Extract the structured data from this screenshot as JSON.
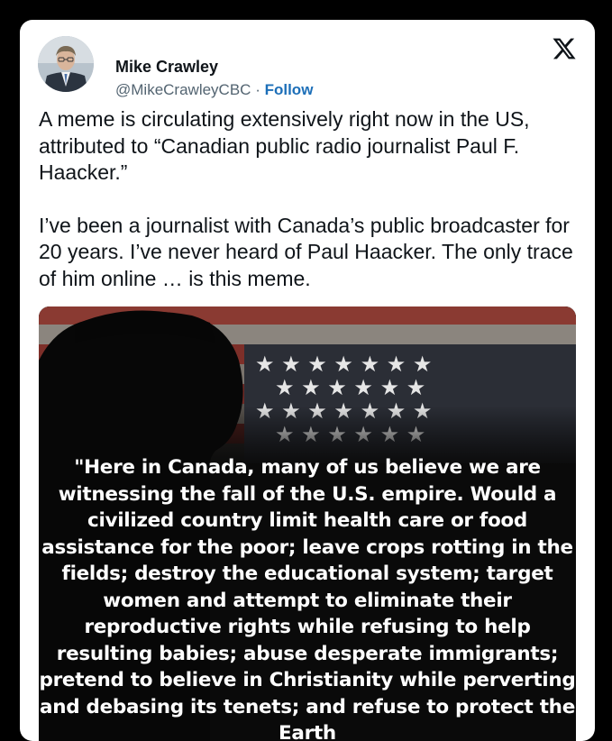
{
  "post": {
    "author_name": "Mike Crawley",
    "handle": "@MikeCrawleyCBC",
    "separator": "·",
    "follow_label": "Follow",
    "paragraphs": [
      "A meme is circulating extensively right now in the US, attributed to “Canadian public radio journalist Paul F. Haacker.”",
      "I’ve been a journalist with Canada’s  public broadcaster for 20 years. I’ve never heard of Paul Haacker. The only trace of him online … is this meme."
    ]
  },
  "meme": {
    "quote": "\"Here in Canada, many of us believe we are witnessing the fall of the U.S. empire. Would a civilized country limit health care or food assistance for the poor; leave crops rotting in the fields; destroy the educational system; target women and attempt to eliminate their reproductive rights while refusing to help resulting babies; abuse desperate immigrants; pretend to believe in Christianity while perverting and debasing its tenets; and refuse to protect the Earth"
  },
  "icons": {
    "platform_logo": "x-logo-icon",
    "avatar": "avatar"
  },
  "colors": {
    "follow_link": "#1d6fb8",
    "handle_gray": "#536471",
    "text": "#0f1419",
    "background": "#000000",
    "card": "#ffffff"
  }
}
